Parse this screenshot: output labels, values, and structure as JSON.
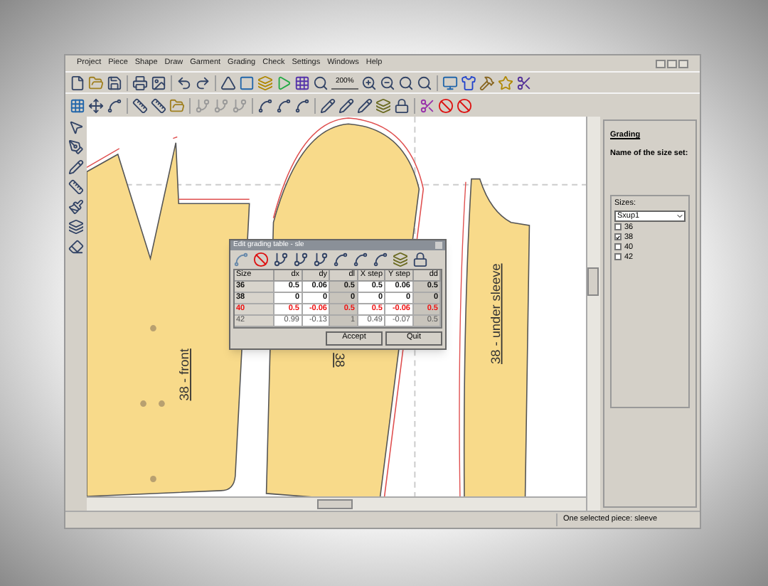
{
  "menu": [
    "Project",
    "Piece",
    "Shape",
    "Draw",
    "Garment",
    "Grading",
    "Check",
    "Settings",
    "Windows",
    "Help"
  ],
  "toolbar": {
    "zoom": "200%"
  },
  "canvas": {
    "labels": [
      {
        "kind": "front",
        "text": "38 - front"
      },
      {
        "kind": "sleeve",
        "text": "38"
      },
      {
        "kind": "under",
        "text": "38 - under sleeve"
      }
    ]
  },
  "dialog": {
    "title": "Edit grading table - sle",
    "columns": [
      "Size",
      "dx",
      "dy",
      "dl",
      "X step",
      "Y step",
      "dd"
    ],
    "rows": [
      {
        "cells": [
          "36",
          "0.5",
          "0.06",
          "0.5",
          "0.5",
          "0.06",
          "0.5"
        ],
        "selected": false
      },
      {
        "cells": [
          "38",
          "0",
          "0",
          "0",
          "0",
          "0",
          "0"
        ],
        "selected": false
      },
      {
        "cells": [
          "40",
          "0.5",
          "-0.06",
          "0.5",
          "0.5",
          "-0.06",
          "0.5"
        ],
        "selected": true
      },
      {
        "cells": [
          "42",
          "0.99",
          "-0.13",
          "1",
          "0.49",
          "-0.07",
          "0.5"
        ],
        "selected": false
      }
    ],
    "buttons": [
      "Accept",
      "Quit"
    ]
  },
  "panel": {
    "title": "Grading",
    "subtitle": "Name of the size set:",
    "group": "Sizes:",
    "select": "Sxup1",
    "sizes": [
      {
        "label": "36",
        "checked": false
      },
      {
        "label": "38",
        "checked": true
      },
      {
        "label": "40",
        "checked": false
      },
      {
        "label": "42",
        "checked": false
      }
    ]
  },
  "status": "One selected piece: sleeve"
}
